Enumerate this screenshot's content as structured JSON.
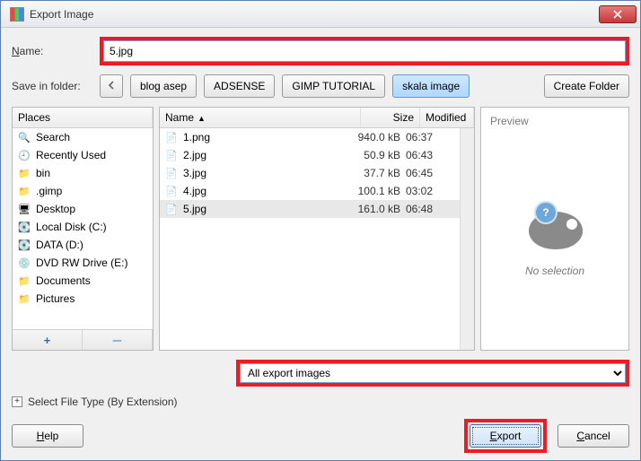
{
  "window": {
    "title": "Export Image"
  },
  "name": {
    "label": "Name:",
    "value": "5.jpg"
  },
  "save_in": {
    "label": "Save in folder:"
  },
  "path": [
    "blog asep",
    "ADSENSE",
    "GIMP TUTORIAL",
    "skala image"
  ],
  "create_folder": "Create Folder",
  "places_header": "Places",
  "places": [
    {
      "label": "Search",
      "icon": "search-icon"
    },
    {
      "label": "Recently Used",
      "icon": "recent-icon"
    },
    {
      "label": "bin",
      "icon": "folder-icon"
    },
    {
      "label": ".gimp",
      "icon": "folder-icon"
    },
    {
      "label": "Desktop",
      "icon": "desktop-icon"
    },
    {
      "label": "Local Disk (C:)",
      "icon": "drive-icon"
    },
    {
      "label": "DATA (D:)",
      "icon": "drive-icon"
    },
    {
      "label": "DVD RW Drive (E:)",
      "icon": "disc-icon"
    },
    {
      "label": "Documents",
      "icon": "folder-icon"
    },
    {
      "label": "Pictures",
      "icon": "folder-icon"
    }
  ],
  "file_headers": {
    "name": "Name",
    "size": "Size",
    "modified": "Modified"
  },
  "files": [
    {
      "name": "1.png",
      "size": "940.0 kB",
      "modified": "06:37"
    },
    {
      "name": "2.jpg",
      "size": "50.9 kB",
      "modified": "06:43"
    },
    {
      "name": "3.jpg",
      "size": "37.7 kB",
      "modified": "06:45"
    },
    {
      "name": "4.jpg",
      "size": "100.1 kB",
      "modified": "03:02"
    },
    {
      "name": "5.jpg",
      "size": "161.0 kB",
      "modified": "06:48"
    }
  ],
  "preview": {
    "title": "Preview",
    "no_selection": "No selection"
  },
  "filter": {
    "value": "All export images"
  },
  "select_filetype": "Select File Type (By Extension)",
  "buttons": {
    "help": "Help",
    "export": "Export",
    "cancel": "Cancel"
  },
  "places_footer": {
    "add": "+",
    "remove": "─"
  }
}
